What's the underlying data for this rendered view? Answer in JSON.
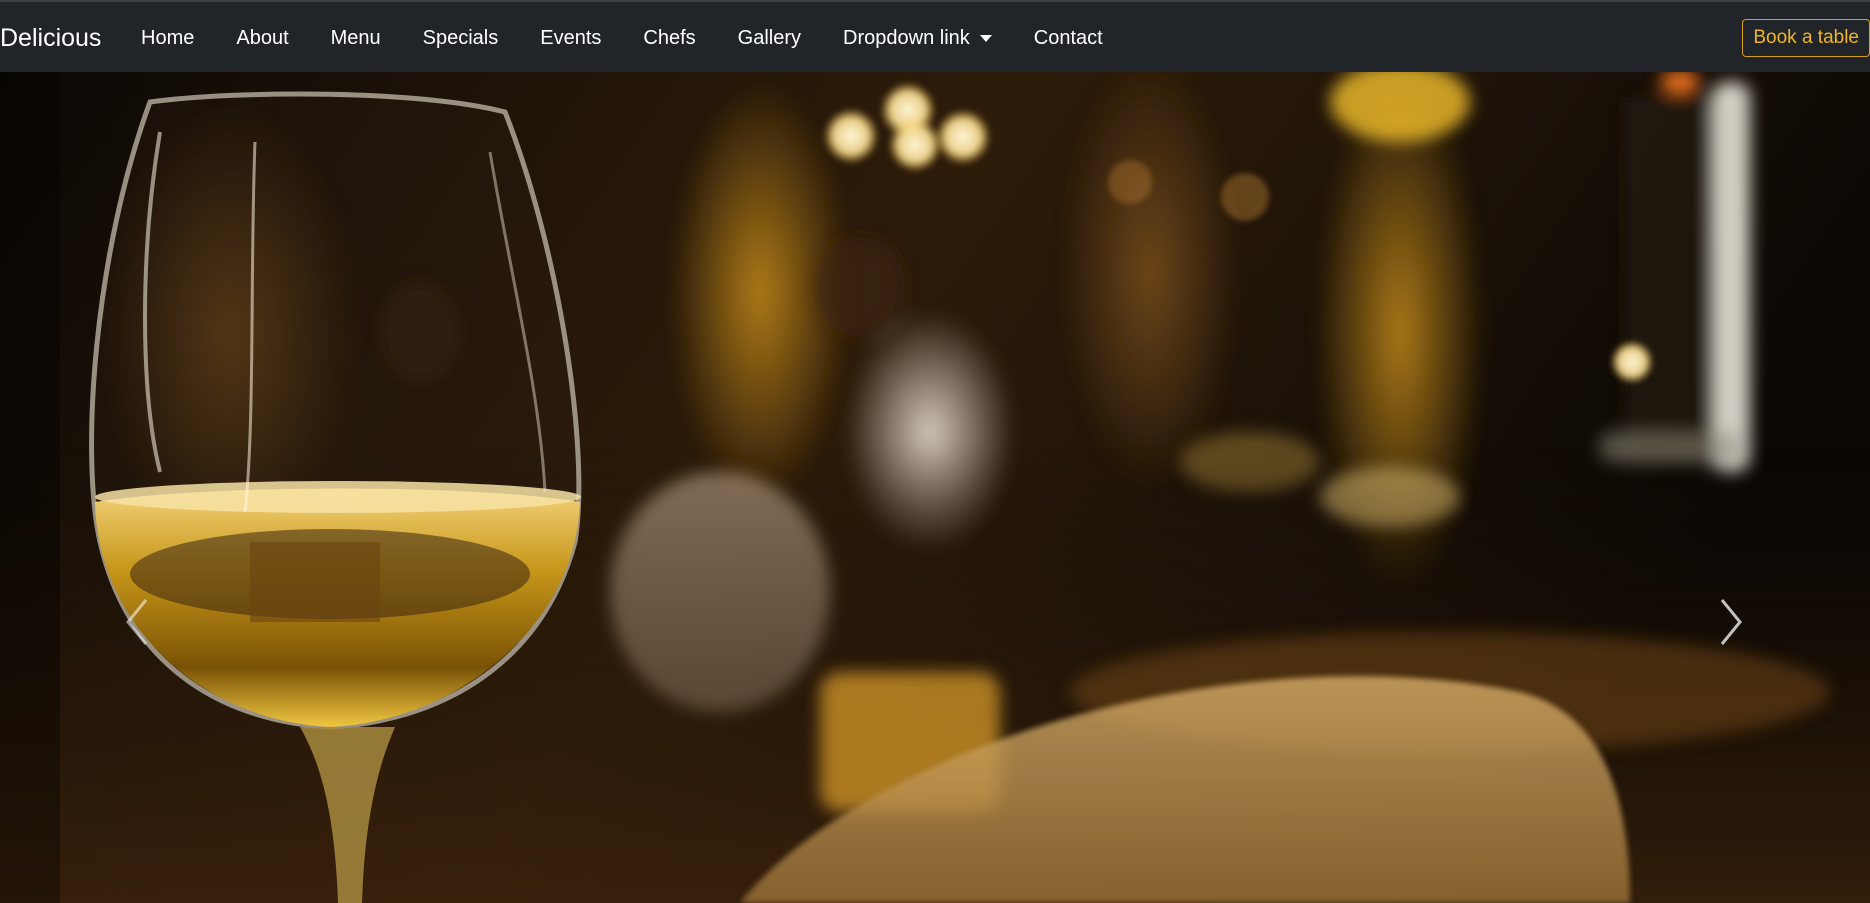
{
  "navbar": {
    "brand": "Delicious",
    "links": [
      {
        "label": "Home"
      },
      {
        "label": "About"
      },
      {
        "label": "Menu"
      },
      {
        "label": "Specials"
      },
      {
        "label": "Events"
      },
      {
        "label": "Chefs"
      },
      {
        "label": "Gallery"
      },
      {
        "label": "Dropdown link",
        "icon": "caret-down-icon"
      },
      {
        "label": "Contact"
      }
    ],
    "book_button": "Book a table"
  },
  "hero": {
    "image": "restaurant-wine-glass-photo",
    "controls": {
      "prev_icon": "chevron-left-icon",
      "next_icon": "chevron-right-icon"
    }
  },
  "colors": {
    "navbar_bg": "#212529",
    "accent": "#f0b429"
  }
}
